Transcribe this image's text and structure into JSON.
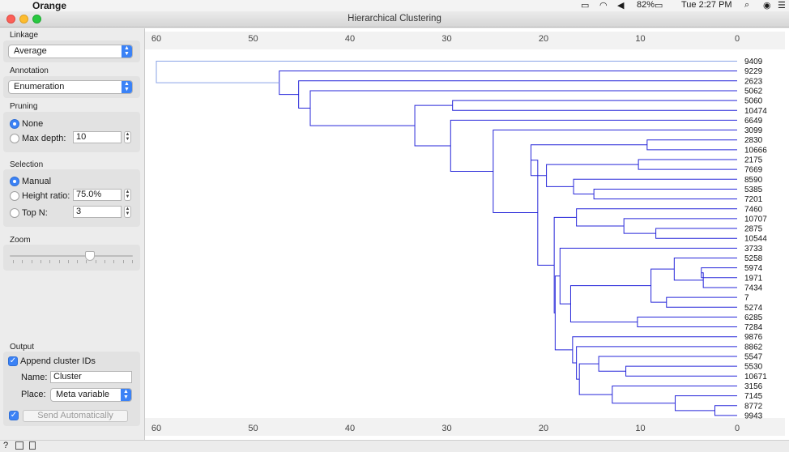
{
  "menubar": {
    "app_name": "Orange",
    "battery": "82%",
    "clock": "Tue 2:27 PM"
  },
  "window": {
    "title": "Hierarchical Clustering"
  },
  "linkage": {
    "label": "Linkage",
    "value": "Average"
  },
  "annotation": {
    "label": "Annotation",
    "value": "Enumeration"
  },
  "pruning": {
    "label": "Pruning",
    "none_label": "None",
    "max_depth_label": "Max depth:",
    "max_depth_value": "10",
    "selected": "None"
  },
  "selection": {
    "label": "Selection",
    "manual_label": "Manual",
    "height_ratio_label": "Height ratio:",
    "height_ratio_value": "75.0%",
    "top_n_label": "Top N:",
    "top_n_value": "3",
    "selected": "Manual"
  },
  "zoom": {
    "label": "Zoom",
    "level": 0.65
  },
  "output": {
    "label": "Output",
    "append_label": "Append cluster IDs",
    "append_checked": true,
    "name_label": "Name:",
    "name_value": "Cluster",
    "place_label": "Place:",
    "place_value": "Meta variable",
    "send_auto_checked": true,
    "send_label": "Send Automatically"
  },
  "colors": {
    "accent": "#3b82f6",
    "dendrogram": "#2626d9",
    "root_line": "#8aa3e6"
  },
  "chart_data": {
    "type": "dendrogram",
    "x_axis_ticks": [
      60,
      50,
      40,
      30,
      20,
      10,
      0
    ],
    "xlim": [
      62,
      -2
    ],
    "leaves": [
      "9409",
      "9229",
      "2623",
      "5062",
      "5060",
      "10474",
      "6649",
      "3099",
      "2830",
      "10666",
      "2175",
      "7669",
      "8590",
      "5385",
      "7201",
      "7460",
      "10707",
      "2875",
      "10544",
      "3733",
      "5258",
      "5974",
      "1971",
      "7434",
      "7",
      "5274",
      "6285",
      "7284",
      "9876",
      "8862",
      "5547",
      "5530",
      "10671",
      "3156",
      "7145",
      "8772",
      "9943"
    ],
    "merges": [
      [
        "L8",
        "L9",
        9.3,
        "A1"
      ],
      [
        "L10",
        "L11",
        10.2,
        "A2"
      ],
      [
        "L13",
        "L14",
        14.8,
        "A3"
      ],
      [
        "L12",
        "A3",
        16.9,
        "A4"
      ],
      [
        "A2",
        "A4",
        19.7,
        "A5"
      ],
      [
        "A1",
        "A5",
        21.3,
        "A6"
      ],
      [
        "L17",
        "L18",
        8.4,
        "A7"
      ],
      [
        "L16",
        "A7",
        11.7,
        "A8"
      ],
      [
        "L15",
        "A8",
        16.6,
        "A9"
      ],
      [
        "L21",
        "L22",
        3.7,
        "A10"
      ],
      [
        "A10",
        "L23",
        3.5,
        "A11"
      ],
      [
        "L20",
        "A11",
        6.5,
        "A12"
      ],
      [
        "L24",
        "L25",
        7.3,
        "A13"
      ],
      [
        "A12",
        "A13",
        8.9,
        "A14"
      ],
      [
        "L26",
        "L27",
        10.3,
        "A15"
      ],
      [
        "A14",
        "A15",
        17.2,
        "A16"
      ],
      [
        "L19",
        "A16",
        18.3,
        "A17"
      ],
      [
        "L31",
        "L32",
        11.5,
        "A18"
      ],
      [
        "L30",
        "A18",
        14.3,
        "A19"
      ],
      [
        "L35",
        "L36",
        2.3,
        "A20"
      ],
      [
        "L34",
        "A20",
        6.4,
        "A21"
      ],
      [
        "L33",
        "A21",
        12.9,
        "A22"
      ],
      [
        "A19",
        "A22",
        16.3,
        "A23"
      ],
      [
        "L29",
        "A23",
        16.6,
        "A24"
      ],
      [
        "L28",
        "A24",
        17.0,
        "A25"
      ],
      [
        "A17",
        "A25",
        18.8,
        "A26"
      ],
      [
        "A9",
        "A26",
        18.9,
        "A27"
      ],
      [
        "A6",
        "A27",
        20.6,
        "A28"
      ],
      [
        "L7",
        "A28",
        25.2,
        "A29"
      ],
      [
        "L6",
        "A29",
        29.6,
        "A30"
      ],
      [
        "L4",
        "L5",
        29.4,
        "A31"
      ],
      [
        "A30",
        "A31",
        33.3,
        "A32"
      ],
      [
        "L3",
        "A32",
        44.1,
        "A33"
      ],
      [
        "L2",
        "A33",
        45.3,
        "A34"
      ],
      [
        "L1",
        "A34",
        47.3,
        "A35"
      ],
      [
        "L0",
        "A35",
        60.0,
        "A36"
      ]
    ]
  }
}
